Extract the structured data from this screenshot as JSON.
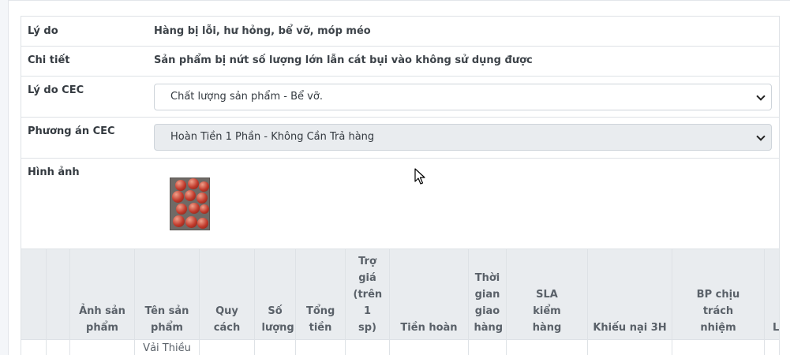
{
  "detail": {
    "reason": {
      "label": "Lý do",
      "value": "Hàng bị lỗi, hư hỏng, bể vỡ, móp méo"
    },
    "details": {
      "label": "Chi tiết",
      "value": "Sản phẩm bị nứt số lượng lớn lẫn cát bụi vào không sử dụng được"
    },
    "cec_reason": {
      "label": "Lý do CEC",
      "selected": "Chất lượng sản phẩm - Bể vỡ."
    },
    "cec_plan": {
      "label": "Phương án CEC",
      "selected": "Hoàn Tiền 1 Phần - Không Cần Trả hàng"
    },
    "images": {
      "label": "Hình ảnh"
    }
  },
  "table": {
    "headers": [
      "",
      "",
      "Ảnh sản phẩm",
      "Tên sản phẩm",
      "Quy cách",
      "Số lượng",
      "Tổng tiền",
      "Trợ giá (trên 1 sp)",
      "Tiền hoàn",
      "Thời gian giao hàng",
      "SLA kiểm hàng",
      "Khiếu nại 3H",
      "BP chịu trách nhiệm",
      "L"
    ],
    "first_row": [
      "",
      "",
      "",
      "Vải Thiều",
      "",
      "",
      "",
      "",
      "",
      "",
      "",
      "",
      "",
      ""
    ]
  },
  "colors": {
    "header_bg": "#e9ecef",
    "border": "#dee2e6",
    "select_disabled_bg": "#e9ecef"
  },
  "icons": {
    "dropdown": "chevron-down-icon",
    "cursor": "mouse-pointer-icon"
  }
}
